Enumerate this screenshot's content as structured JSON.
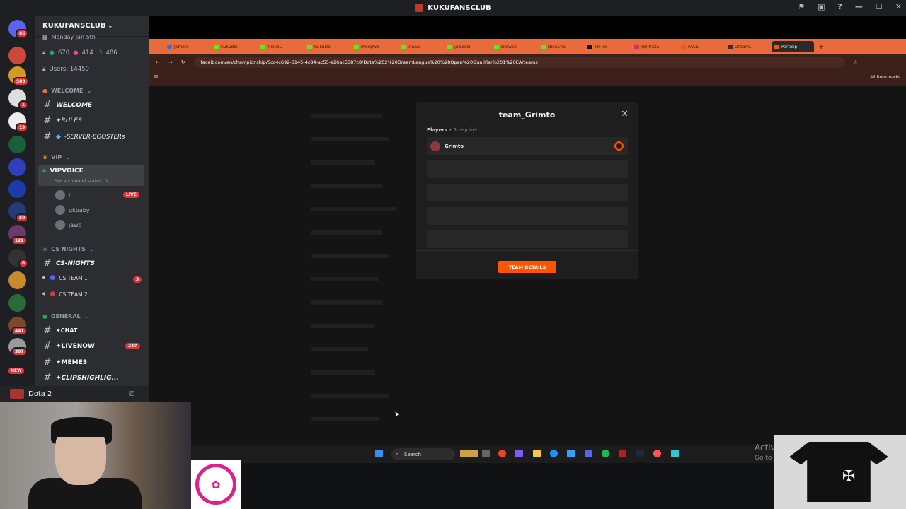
{
  "window": {
    "title": "KUKUFANSCLUB"
  },
  "server": {
    "name": "KUKUFANSCLUB"
  },
  "top_info": {
    "date": "Monday Jan 5th",
    "green_count": "670",
    "pink_count": "414",
    "moon_count": "486",
    "users": "Users: 14450"
  },
  "server_badges": [
    "66",
    "589",
    "1",
    "19",
    "50",
    "122",
    "6",
    "441",
    "307",
    "NEW"
  ],
  "categories": {
    "welcome": "WELCOME",
    "vip": "VIP",
    "cs_nights": "CS NIGHTS",
    "general": "GENERAL"
  },
  "channels": {
    "welcome": "WELCOME",
    "rules": "✦RULES",
    "boosters": "-SERVER-BOOSTERs",
    "vipvoice": "VIPVOICE",
    "vip_status": "Set a channel status",
    "cs_nights": "CS-NIGHTS",
    "cs_team1": "CS TEAM 1",
    "cs_team1_count": "3",
    "cs_team2": "CS TEAM 2",
    "chat": "✦CHAT",
    "livenow": "✦LIVENOW",
    "livenow_count": "247",
    "memes": "✦MEMES",
    "clips": "✦CLIPSHIGHLIG..."
  },
  "voice_users": [
    {
      "name": "t...",
      "live": "LIVE"
    },
    {
      "name": "gkbaby"
    },
    {
      "name": "jawo"
    }
  ],
  "voice_panel": {
    "game": "Dota 2"
  },
  "browser": {
    "tabs": [
      "Jomari",
      "Kukudol",
      "NikkoD",
      "KukuDo",
      "meepwo",
      "Jinuuu",
      "jawocol",
      "Browse",
      "NicaCha",
      "TikTok",
      "(9) Insta",
      "FACEIT",
      "DreamL",
      "Particip"
    ],
    "url": "faceit.com/en/championship/6cc4c692-6145-4c84-ac55-a26ac5587c8/Dota%202%20DreamLeague%20%28Open%20Qualifier%201%20EA/teams",
    "bookmarks": "All Bookmarks"
  },
  "modal": {
    "title": "team_Grimto",
    "players_label": "Players",
    "required": " • 5 required",
    "player1": "Grimto",
    "button": "TEAM DETAILS"
  },
  "taskbar": {
    "search": "Search"
  },
  "activate": {
    "line1": "Activ",
    "line2": "Go to"
  }
}
